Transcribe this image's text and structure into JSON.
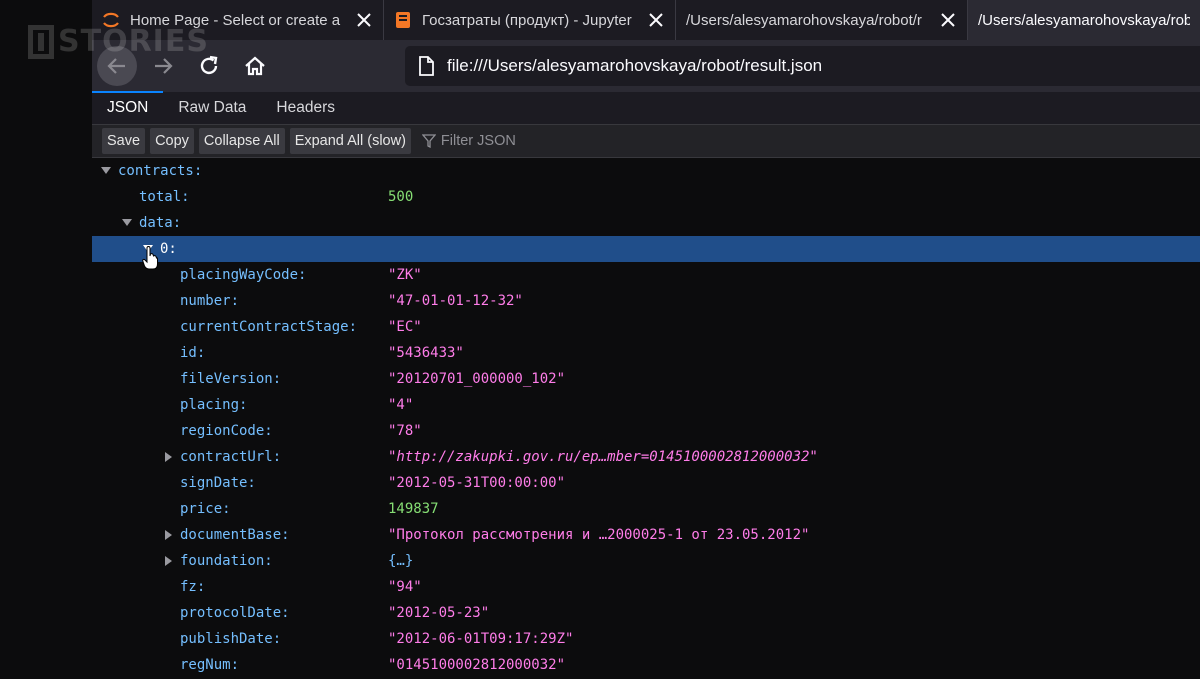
{
  "watermark": "STORIES",
  "tabs": [
    {
      "title": "Home Page - Select or create a",
      "icon": "jupyter-icon"
    },
    {
      "title": "Госзатраты (продукт) - Jupyter",
      "icon": "notebook-icon"
    },
    {
      "title": "/Users/alesyamarohovskaya/robot/r",
      "icon": "none"
    },
    {
      "title": "/Users/alesyamarohovskaya/robo",
      "icon": "none",
      "active": true
    }
  ],
  "nav": {
    "url": "file:///Users/alesyamarohovskaya/robot/result.json"
  },
  "viewer_tabs": [
    "JSON",
    "Raw Data",
    "Headers"
  ],
  "toolbar": {
    "save": "Save",
    "copy": "Copy",
    "collapse_all": "Collapse All",
    "expand_all": "Expand All (slow)",
    "filter_placeholder": "Filter JSON"
  },
  "tree": {
    "contracts_key": "contracts:",
    "total_key": "total:",
    "total_val": "500",
    "data_key": "data:",
    "item0_key": "0:",
    "fields": [
      {
        "key": "placingWayCode:",
        "value": "\"ZK\"",
        "type": "str"
      },
      {
        "key": "number:",
        "value": "\"47-01-01-12-32\"",
        "type": "str"
      },
      {
        "key": "currentContractStage:",
        "value": "\"EC\"",
        "type": "str"
      },
      {
        "key": "id:",
        "value": "\"5436433\"",
        "type": "str"
      },
      {
        "key": "fileVersion:",
        "value": "\"20120701_000000_102\"",
        "type": "str"
      },
      {
        "key": "placing:",
        "value": "\"4\"",
        "type": "str"
      },
      {
        "key": "regionCode:",
        "value": "\"78\"",
        "type": "str"
      },
      {
        "key": "contractUrl:",
        "value": "\"http://zakupki.gov.ru/ep…mber=0145100002812000032\"",
        "type": "url",
        "expandable": true
      },
      {
        "key": "signDate:",
        "value": "\"2012-05-31T00:00:00\"",
        "type": "str"
      },
      {
        "key": "price:",
        "value": "149837",
        "type": "num"
      },
      {
        "key": "documentBase:",
        "value": "\"Протокол рассмотрения и …2000025-1 от 23.05.2012\"",
        "type": "str",
        "expandable": true
      },
      {
        "key": "foundation:",
        "value": "{…}",
        "type": "obj",
        "expandable": true
      },
      {
        "key": "fz:",
        "value": "\"94\"",
        "type": "str"
      },
      {
        "key": "protocolDate:",
        "value": "\"2012-05-23\"",
        "type": "str"
      },
      {
        "key": "publishDate:",
        "value": "\"2012-06-01T09:17:29Z\"",
        "type": "str"
      },
      {
        "key": "regNum:",
        "value": "\"0145100002812000032\"",
        "type": "str"
      }
    ]
  }
}
